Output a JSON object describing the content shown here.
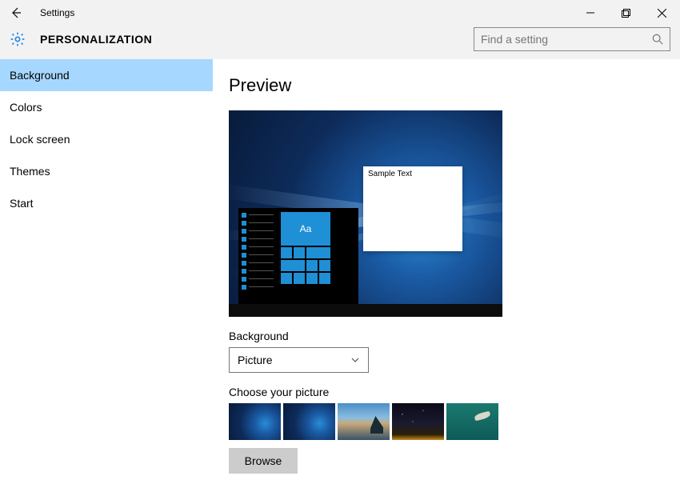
{
  "titlebar": {
    "app_name": "Settings"
  },
  "header": {
    "title": "PERSONALIZATION",
    "search_placeholder": "Find a setting"
  },
  "sidebar": {
    "items": [
      {
        "label": "Background",
        "active": true
      },
      {
        "label": "Colors",
        "active": false
      },
      {
        "label": "Lock screen",
        "active": false
      },
      {
        "label": "Themes",
        "active": false
      },
      {
        "label": "Start",
        "active": false
      }
    ]
  },
  "main": {
    "preview_heading": "Preview",
    "sample_window_text": "Sample Text",
    "tile_text": "Aa",
    "background_label": "Background",
    "background_value": "Picture",
    "choose_label": "Choose your picture",
    "browse_label": "Browse"
  }
}
